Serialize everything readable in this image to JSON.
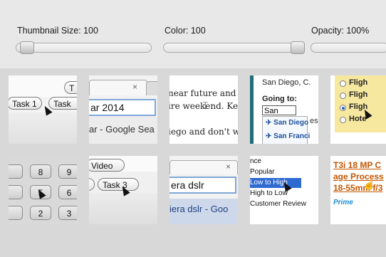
{
  "controls": {
    "thumbnail_size_label": "Thumbnail Size: 100",
    "color_label": "Color: 100",
    "opacity_label": "Opacity: 100%"
  },
  "thumbnails": {
    "t1": {
      "partial": "T",
      "task1": "Task 1",
      "task2": "Task"
    },
    "t2": {
      "close": "×",
      "url": "ar 2014",
      "suggestion": "ar - Google Sea"
    },
    "t3": {
      "line1": "near future and",
      "line2": "ire weekend.  Ke",
      "line3": "iego and don't w"
    },
    "t4": {
      "from": "San Diego, C.",
      "going_to": "Going to:",
      "input": "San",
      "opt1": "San Diego",
      "opt2": "San Franci",
      "partial": "es"
    },
    "t5": {
      "o1": "Fligh",
      "o2": "Fligh",
      "o3": "Fligh",
      "o4": "Hote"
    },
    "t6": {
      "k1": "8",
      "k2": "9",
      "k3": "5",
      "k4": "6",
      "k5": "2",
      "k6": "3"
    },
    "t7": {
      "video": "Video",
      "task3": "Task 3"
    },
    "t8": {
      "close": "×",
      "url": "era dslr",
      "suggestion": "iera dslr - Goo"
    },
    "t9": {
      "i1": "nce",
      "i2": "Popular",
      "i3": "Low to High",
      "i4": "High to Low",
      "i5": "Customer Review"
    },
    "t10": {
      "l1": "T3i 18 MP C",
      "l2": "age Process",
      "l3": "18-55mm f/3",
      "prime": "Prime"
    }
  }
}
